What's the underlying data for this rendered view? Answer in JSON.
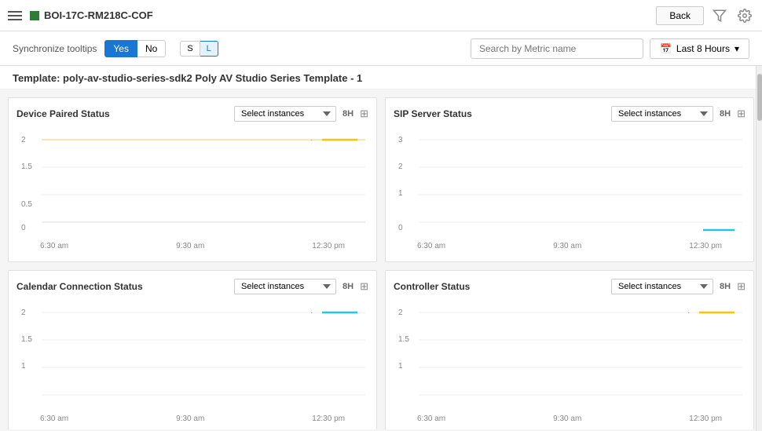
{
  "topbar": {
    "menu_label": "menu",
    "device_name": "BOI-17C-RM218C-COF",
    "back_label": "Back",
    "filter_icon": "▽",
    "settings_icon": "⚙"
  },
  "controls": {
    "sync_label": "Synchronize tooltips",
    "yes_label": "Yes",
    "no_label": "No",
    "size_s": "S",
    "size_l": "L",
    "search_placeholder": "Search by Metric name",
    "time_range_label": "Last 8 Hours",
    "calendar_icon": "📅"
  },
  "template": {
    "title": "Template: poly-av-studio-series-sdk2 Poly AV Studio Series Template - 1"
  },
  "charts": [
    {
      "id": "device-paired-status",
      "title": "Device Paired Status",
      "select_placeholder": "Select instances",
      "time_label": "8H",
      "y_values": [
        "2",
        "1.5",
        "0.5",
        "0"
      ],
      "x_labels": [
        "6:30 am",
        "9:30 am",
        "12:30 pm"
      ],
      "legend_dot": "·",
      "line_color": "#ffc107"
    },
    {
      "id": "sip-server-status",
      "title": "SIP Server Status",
      "select_placeholder": "Select instances",
      "time_label": "8H",
      "y_values": [
        "3",
        "2",
        "1",
        "0"
      ],
      "x_labels": [
        "6:30 am",
        "9:30 am",
        "12:30 pm"
      ],
      "legend_dot": "·",
      "line_color": "#26c6da"
    },
    {
      "id": "calendar-connection-status",
      "title": "Calendar Connection Status",
      "select_placeholder": "Select instances",
      "time_label": "8H",
      "y_values": [
        "2",
        "1.5",
        "1"
      ],
      "x_labels": [
        "6:30 am",
        "9:30 am",
        "12:30 pm"
      ],
      "legend_dot": "·",
      "line_color": "#26c6da"
    },
    {
      "id": "controller-status",
      "title": "Controller Status",
      "select_placeholder": "Select instances",
      "time_label": "8H",
      "y_values": [
        "2",
        "1.5",
        "1"
      ],
      "x_labels": [
        "6:30 am",
        "9:30 am",
        "12:30 pm"
      ],
      "legend_dot": "·",
      "line_color": "#ffc107"
    }
  ]
}
